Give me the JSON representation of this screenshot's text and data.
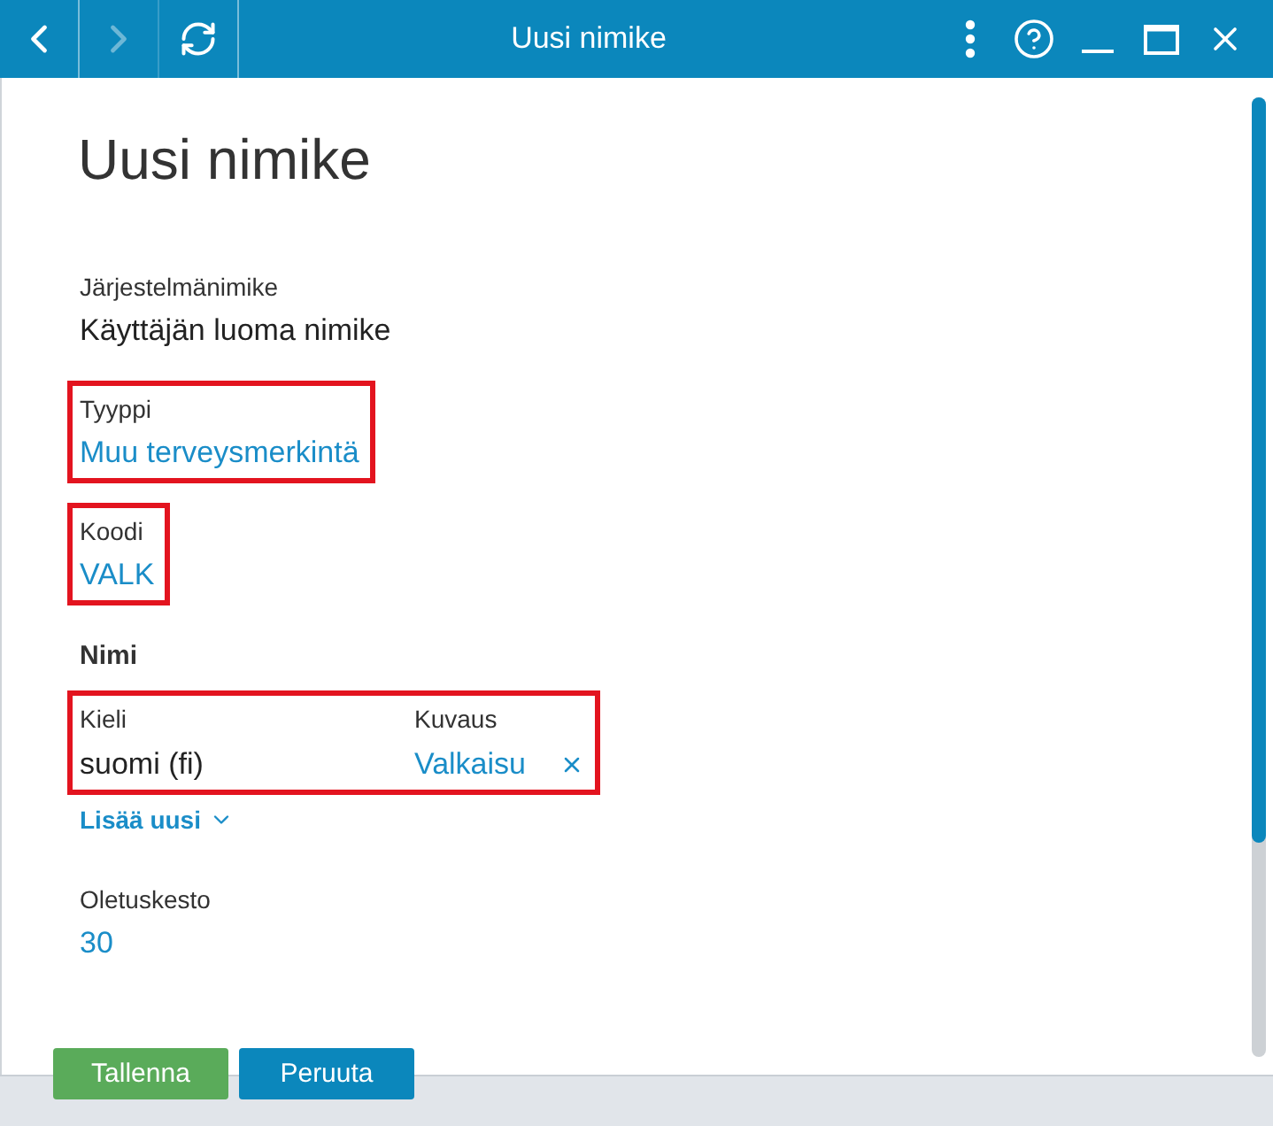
{
  "window": {
    "title": "Uusi nimike",
    "nav": [
      {
        "kind": "back",
        "disabled": false
      },
      {
        "kind": "forward",
        "disabled": true
      },
      {
        "kind": "refresh",
        "disabled": false
      }
    ],
    "controls": [
      {
        "kind": "more"
      },
      {
        "kind": "help"
      },
      {
        "kind": "minimize"
      },
      {
        "kind": "maximize"
      },
      {
        "kind": "close"
      }
    ]
  },
  "page": {
    "heading": "Uusi nimike",
    "sections": [
      {
        "kind": "field",
        "label": "Järjestelmänimike",
        "value": "Käyttäjän luoma nimike",
        "link": false,
        "highlighted": false
      },
      {
        "kind": "field",
        "label": "Tyyppi",
        "value": "Muu terveysmerkintä",
        "link": true,
        "highlighted": true
      },
      {
        "kind": "field",
        "label": "Koodi",
        "value": "VALK",
        "link": true,
        "highlighted": true
      },
      {
        "kind": "translations",
        "title": "Nimi",
        "highlighted": true,
        "columns": [
          "Kieli",
          "Kuvaus"
        ],
        "rows": [
          {
            "language": "suomi (fi)",
            "description": "Valkaisu",
            "removable": true
          }
        ],
        "add_label": "Lisää uusi"
      },
      {
        "kind": "field",
        "label": "Oletuskesto",
        "value": "30",
        "link": true,
        "highlighted": false
      }
    ]
  },
  "buttons": [
    {
      "label": "Tallenna",
      "kind": "primary"
    },
    {
      "label": "Peruuta",
      "kind": "secondary"
    }
  ]
}
